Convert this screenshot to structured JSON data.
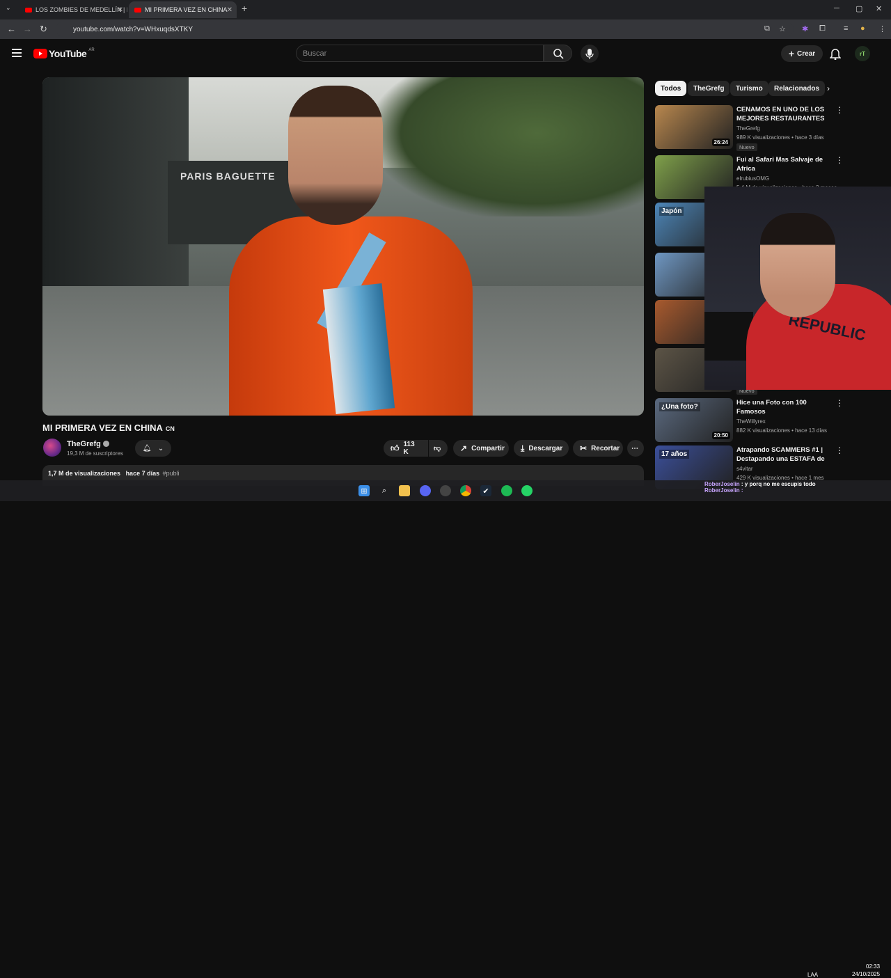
{
  "browser": {
    "tabs": [
      {
        "title": "LOS ZOMBIES DE MEDELLÍN | E",
        "active": false
      },
      {
        "title": "MI PRIMERA VEZ EN CHINA",
        "active": true
      }
    ],
    "url": "youtube.com/watch?v=WHxuqdsXTKY"
  },
  "youtube": {
    "logo_text": "YouTube",
    "country": "AR",
    "search_placeholder": "Buscar",
    "create_label": "Crear",
    "avatar_initials": "rT"
  },
  "video": {
    "title": "MI PRIMERA VEZ EN CHINA",
    "flag": "CN",
    "store_sign": "PARIS BAGUETTE",
    "channel": "TheGrefg",
    "subscribers": "19,3 M de suscriptores",
    "likes": "113 K",
    "share_label": "Compartir",
    "download_label": "Descargar",
    "clip_label": "Recortar",
    "views": "1,7 M de visualizaciones",
    "age": "hace 7 días",
    "hashtag": "#publi"
  },
  "chips": [
    "Todos",
    "TheGrefg",
    "Turismo",
    "Relacionados"
  ],
  "recommendations": [
    {
      "title": "CENAMOS EN UNO DE LOS MEJORES RESTAURANTES ...",
      "channel": "TheGrefg",
      "meta": "989 K visualizaciones • hace 3 días",
      "duration": "26:24",
      "badge": "Nuevo",
      "color": "#b8874e"
    },
    {
      "title": "Fui al Safari Mas Salvaje de Africa",
      "channel": "elrubiusOMG",
      "meta": "5,4 M de visualizaciones • hace 2 meses",
      "duration": "",
      "badge": "",
      "color": "#7fa04a"
    },
    {
      "title": "",
      "channel": "",
      "meta": "",
      "duration": "",
      "badge": "",
      "color": "#4d86b8",
      "thumb_text": "Japón"
    },
    {
      "title": "",
      "channel": "",
      "meta": "",
      "duration": "",
      "badge": "",
      "color": "#6f97c2"
    },
    {
      "title": "",
      "channel": "",
      "meta": "",
      "duration": "",
      "badge": "",
      "color": "#a85a2e"
    },
    {
      "title": "",
      "channel": "",
      "meta": "",
      "duration": "",
      "badge": "Nuevo",
      "color": "#5c5446"
    },
    {
      "title": "Hice una Foto con 100 Famosos",
      "channel": "TheWillyrex",
      "meta": "882 K visualizaciones • hace 13 días",
      "duration": "20:50",
      "badge": "",
      "color": "#5b6a80",
      "thumb_text": "¿Una foto?"
    },
    {
      "title": "Atrapando SCAMMERS #1 | Destapando una ESTAFA de ...",
      "channel": "s4vitar",
      "meta": "429 K visualizaciones • hace 1 mes",
      "duration": "",
      "badge": "",
      "color": "#3b4f9a",
      "thumb_text": "17 años"
    }
  ],
  "webcam": {
    "shirt_text": "REPUBLIC"
  },
  "stream_chat": {
    "user": "RoberJoselin",
    "message": ": y porq no me escupis todo",
    "user2": "RoberJoselin :"
  },
  "taskbar": {
    "lang": "LAA",
    "time": "02:33",
    "date": "24/10/2025"
  }
}
